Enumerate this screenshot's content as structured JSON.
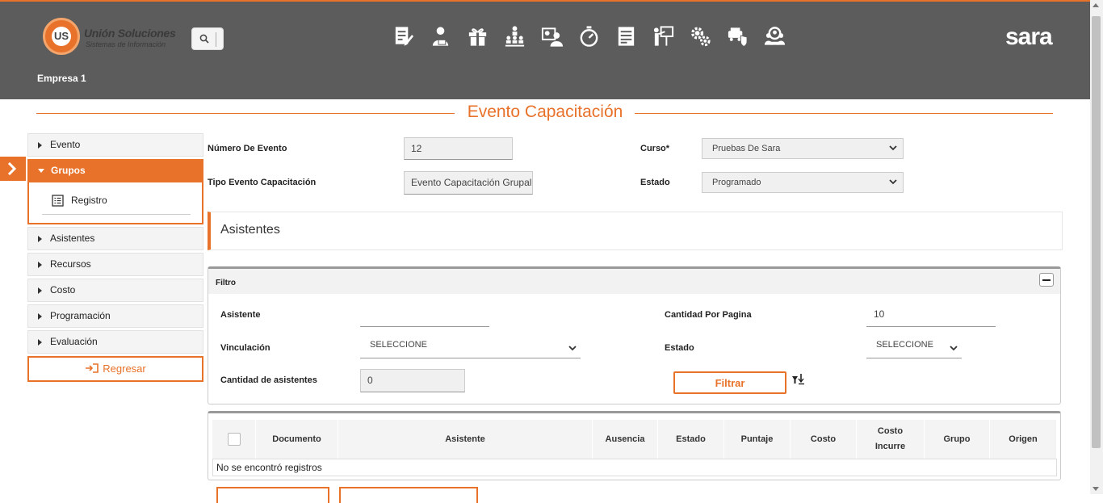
{
  "header": {
    "logo_line1": "Unión Soluciones",
    "logo_line2": "Sistemas de Información",
    "logo_mark": "US",
    "brand": "sara",
    "company": "Empresa 1",
    "nav_icons": [
      "document-edit-icon",
      "person-id-icon",
      "gift-icon",
      "hierarchy-icon",
      "people-card-icon",
      "stopwatch-icon",
      "list-document-icon",
      "presentation-icon",
      "gears-icon",
      "shield-car-icon",
      "group-search-icon"
    ]
  },
  "page": {
    "title": "Evento Capacitación"
  },
  "sidebar": {
    "items": [
      {
        "label": "Evento"
      },
      {
        "label": "Grupos"
      },
      {
        "label": "Asistentes"
      },
      {
        "label": "Recursos"
      },
      {
        "label": "Costo"
      },
      {
        "label": "Programación"
      },
      {
        "label": "Evaluación"
      }
    ],
    "sub_item": "Registro",
    "back_label": "Regresar"
  },
  "form": {
    "numero_label": "Número De Evento",
    "numero_value": "12",
    "tipo_label": "Tipo Evento Capacitación",
    "tipo_value": "Evento Capacitación Grupal",
    "curso_label": "Curso*",
    "curso_value": "Pruebas De Sara",
    "estado_label": "Estado",
    "estado_value": "Programado"
  },
  "asistentes": {
    "title": "Asistentes"
  },
  "filtro": {
    "title": "Filtro",
    "asistente_label": "Asistente",
    "asistente_value": "",
    "cantidad_pagina_label": "Cantidad Por Pagina",
    "cantidad_pagina_value": "10",
    "vinculacion_label": "Vinculación",
    "vinculacion_value": "SELECCIONE",
    "estado_label": "Estado",
    "estado_value": "SELECCIONE",
    "cantidad_asistentes_label": "Cantidad de asistentes",
    "cantidad_asistentes_value": "0",
    "filtrar_label": "Filtrar"
  },
  "table": {
    "columns": [
      "Documento",
      "Asistente",
      "Ausencia",
      "Estado",
      "Puntaje",
      "Costo",
      "Costo Incurre",
      "Grupo",
      "Origen"
    ],
    "empty": "No se encontró registros"
  },
  "colors": {
    "accent": "#e8722a",
    "header_bg": "#5c5c5c"
  }
}
